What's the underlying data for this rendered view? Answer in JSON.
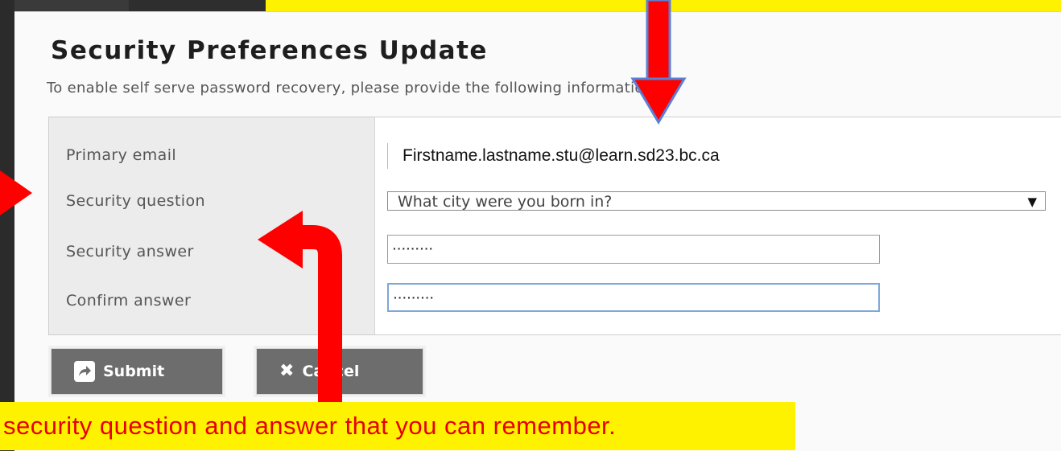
{
  "dialog": {
    "title": "Security Preferences Update",
    "subtitle": "To enable self serve password recovery, please provide the following information"
  },
  "form": {
    "email_label": "Primary email",
    "email_value": "Firstname.lastname.stu@learn.sd23.bc.ca",
    "question_label": "Security question",
    "question_value": "What city were you born in?",
    "answer_label": "Security answer",
    "answer_value": "·········",
    "confirm_label": "Confirm answer",
    "confirm_value": "·········"
  },
  "buttons": {
    "submit_label": "Submit",
    "cancel_label": "Cancel"
  },
  "annotation": {
    "caption": "security question and answer that you can remember.",
    "arrow_color": "#ff0000",
    "highlight_color": "#fff200"
  },
  "icons": [
    "share-icon",
    "close-icon",
    "dropdown-arrow-icon"
  ]
}
